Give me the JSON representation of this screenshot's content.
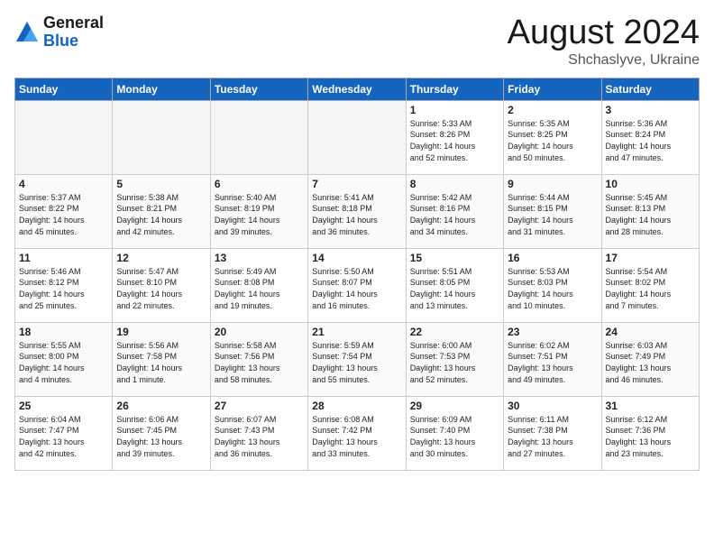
{
  "logo": {
    "general": "General",
    "blue": "Blue"
  },
  "title": {
    "month_year": "August 2024",
    "location": "Shchaslyve, Ukraine"
  },
  "days_of_week": [
    "Sunday",
    "Monday",
    "Tuesday",
    "Wednesday",
    "Thursday",
    "Friday",
    "Saturday"
  ],
  "weeks": [
    [
      {
        "day": "",
        "info": ""
      },
      {
        "day": "",
        "info": ""
      },
      {
        "day": "",
        "info": ""
      },
      {
        "day": "",
        "info": ""
      },
      {
        "day": "1",
        "info": "Sunrise: 5:33 AM\nSunset: 8:26 PM\nDaylight: 14 hours\nand 52 minutes."
      },
      {
        "day": "2",
        "info": "Sunrise: 5:35 AM\nSunset: 8:25 PM\nDaylight: 14 hours\nand 50 minutes."
      },
      {
        "day": "3",
        "info": "Sunrise: 5:36 AM\nSunset: 8:24 PM\nDaylight: 14 hours\nand 47 minutes."
      }
    ],
    [
      {
        "day": "4",
        "info": "Sunrise: 5:37 AM\nSunset: 8:22 PM\nDaylight: 14 hours\nand 45 minutes."
      },
      {
        "day": "5",
        "info": "Sunrise: 5:38 AM\nSunset: 8:21 PM\nDaylight: 14 hours\nand 42 minutes."
      },
      {
        "day": "6",
        "info": "Sunrise: 5:40 AM\nSunset: 8:19 PM\nDaylight: 14 hours\nand 39 minutes."
      },
      {
        "day": "7",
        "info": "Sunrise: 5:41 AM\nSunset: 8:18 PM\nDaylight: 14 hours\nand 36 minutes."
      },
      {
        "day": "8",
        "info": "Sunrise: 5:42 AM\nSunset: 8:16 PM\nDaylight: 14 hours\nand 34 minutes."
      },
      {
        "day": "9",
        "info": "Sunrise: 5:44 AM\nSunset: 8:15 PM\nDaylight: 14 hours\nand 31 minutes."
      },
      {
        "day": "10",
        "info": "Sunrise: 5:45 AM\nSunset: 8:13 PM\nDaylight: 14 hours\nand 28 minutes."
      }
    ],
    [
      {
        "day": "11",
        "info": "Sunrise: 5:46 AM\nSunset: 8:12 PM\nDaylight: 14 hours\nand 25 minutes."
      },
      {
        "day": "12",
        "info": "Sunrise: 5:47 AM\nSunset: 8:10 PM\nDaylight: 14 hours\nand 22 minutes."
      },
      {
        "day": "13",
        "info": "Sunrise: 5:49 AM\nSunset: 8:08 PM\nDaylight: 14 hours\nand 19 minutes."
      },
      {
        "day": "14",
        "info": "Sunrise: 5:50 AM\nSunset: 8:07 PM\nDaylight: 14 hours\nand 16 minutes."
      },
      {
        "day": "15",
        "info": "Sunrise: 5:51 AM\nSunset: 8:05 PM\nDaylight: 14 hours\nand 13 minutes."
      },
      {
        "day": "16",
        "info": "Sunrise: 5:53 AM\nSunset: 8:03 PM\nDaylight: 14 hours\nand 10 minutes."
      },
      {
        "day": "17",
        "info": "Sunrise: 5:54 AM\nSunset: 8:02 PM\nDaylight: 14 hours\nand 7 minutes."
      }
    ],
    [
      {
        "day": "18",
        "info": "Sunrise: 5:55 AM\nSunset: 8:00 PM\nDaylight: 14 hours\nand 4 minutes."
      },
      {
        "day": "19",
        "info": "Sunrise: 5:56 AM\nSunset: 7:58 PM\nDaylight: 14 hours\nand 1 minute."
      },
      {
        "day": "20",
        "info": "Sunrise: 5:58 AM\nSunset: 7:56 PM\nDaylight: 13 hours\nand 58 minutes."
      },
      {
        "day": "21",
        "info": "Sunrise: 5:59 AM\nSunset: 7:54 PM\nDaylight: 13 hours\nand 55 minutes."
      },
      {
        "day": "22",
        "info": "Sunrise: 6:00 AM\nSunset: 7:53 PM\nDaylight: 13 hours\nand 52 minutes."
      },
      {
        "day": "23",
        "info": "Sunrise: 6:02 AM\nSunset: 7:51 PM\nDaylight: 13 hours\nand 49 minutes."
      },
      {
        "day": "24",
        "info": "Sunrise: 6:03 AM\nSunset: 7:49 PM\nDaylight: 13 hours\nand 46 minutes."
      }
    ],
    [
      {
        "day": "25",
        "info": "Sunrise: 6:04 AM\nSunset: 7:47 PM\nDaylight: 13 hours\nand 42 minutes."
      },
      {
        "day": "26",
        "info": "Sunrise: 6:06 AM\nSunset: 7:45 PM\nDaylight: 13 hours\nand 39 minutes."
      },
      {
        "day": "27",
        "info": "Sunrise: 6:07 AM\nSunset: 7:43 PM\nDaylight: 13 hours\nand 36 minutes."
      },
      {
        "day": "28",
        "info": "Sunrise: 6:08 AM\nSunset: 7:42 PM\nDaylight: 13 hours\nand 33 minutes."
      },
      {
        "day": "29",
        "info": "Sunrise: 6:09 AM\nSunset: 7:40 PM\nDaylight: 13 hours\nand 30 minutes."
      },
      {
        "day": "30",
        "info": "Sunrise: 6:11 AM\nSunset: 7:38 PM\nDaylight: 13 hours\nand 27 minutes."
      },
      {
        "day": "31",
        "info": "Sunrise: 6:12 AM\nSunset: 7:36 PM\nDaylight: 13 hours\nand 23 minutes."
      }
    ]
  ]
}
